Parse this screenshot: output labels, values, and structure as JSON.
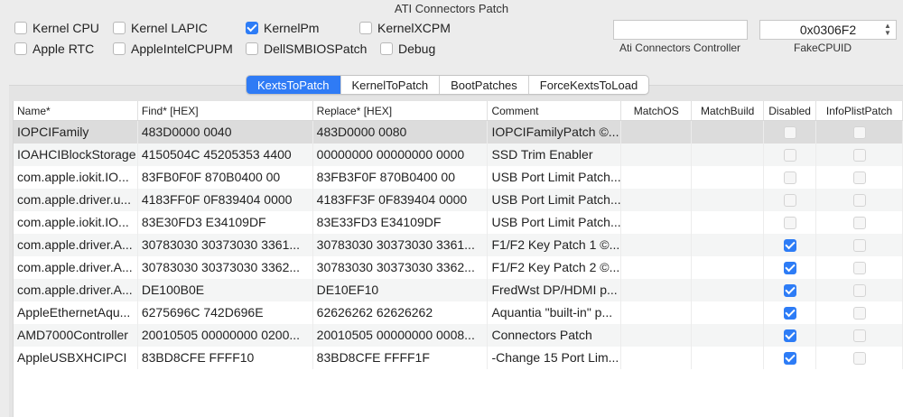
{
  "group_title": "ATI Connectors Patch",
  "checkboxes": [
    {
      "label": "Kernel CPU",
      "checked": false
    },
    {
      "label": "Kernel LAPIC",
      "checked": false
    },
    {
      "label": "KernelPm",
      "checked": true
    },
    {
      "label": "KernelXCPM",
      "checked": false
    },
    {
      "label": "Apple RTC",
      "checked": false
    },
    {
      "label": "AppleIntelCPUPM",
      "checked": false
    },
    {
      "label": "DellSMBIOSPatch",
      "checked": false
    },
    {
      "label": "Debug",
      "checked": false
    }
  ],
  "ati_controller": {
    "value": "",
    "label": "Ati Connectors Controller"
  },
  "fake_cpuid": {
    "value": "0x0306F2",
    "label": "FakeCPUID"
  },
  "tabs": [
    {
      "label": "KextsToPatch",
      "active": true
    },
    {
      "label": "KernelToPatch",
      "active": false
    },
    {
      "label": "BootPatches",
      "active": false
    },
    {
      "label": "ForceKextsToLoad",
      "active": false
    }
  ],
  "table": {
    "columns": [
      "Name*",
      "Find* [HEX]",
      "Replace* [HEX]",
      "Comment",
      "MatchOS",
      "MatchBuild",
      "Disabled",
      "InfoPlistPatch"
    ],
    "rows": [
      {
        "name": "IOPCIFamily",
        "find": "483D0000 0040",
        "replace": "483D0000 0080",
        "comment": "IOPCIFamilyPatch ©...",
        "matchos": "",
        "matchbuild": "",
        "disabled": false,
        "infoplist": false
      },
      {
        "name": "IOAHCIBlockStorage",
        "find": "4150504C 45205353 4400",
        "replace": "00000000 00000000 0000",
        "comment": "SSD Trim Enabler",
        "matchos": "",
        "matchbuild": "",
        "disabled": false,
        "infoplist": false
      },
      {
        "name": "com.apple.iokit.IO...",
        "find": "83FB0F0F 870B0400 00",
        "replace": "83FB3F0F 870B0400 00",
        "comment": "USB Port Limit Patch...",
        "matchos": "",
        "matchbuild": "",
        "disabled": false,
        "infoplist": false
      },
      {
        "name": "com.apple.driver.u...",
        "find": "4183FF0F 0F839404 0000",
        "replace": "4183FF3F 0F839404 0000",
        "comment": "USB Port Limit Patch...",
        "matchos": "",
        "matchbuild": "",
        "disabled": false,
        "infoplist": false
      },
      {
        "name": "com.apple.iokit.IO...",
        "find": "83E30FD3 E34109DF",
        "replace": "83E33FD3 E34109DF",
        "comment": "USB Port Limit Patch...",
        "matchos": "",
        "matchbuild": "",
        "disabled": false,
        "infoplist": false
      },
      {
        "name": "com.apple.driver.A...",
        "find": "30783030 30373030 3361...",
        "replace": "30783030 30373030 3361...",
        "comment": "F1/F2 Key Patch 1 ©...",
        "matchos": "",
        "matchbuild": "",
        "disabled": true,
        "infoplist": false
      },
      {
        "name": "com.apple.driver.A...",
        "find": "30783030 30373030 3362...",
        "replace": "30783030 30373030 3362...",
        "comment": "F1/F2 Key Patch 2 ©...",
        "matchos": "",
        "matchbuild": "",
        "disabled": true,
        "infoplist": false
      },
      {
        "name": "com.apple.driver.A...",
        "find": "DE100B0E",
        "replace": "DE10EF10",
        "comment": "FredWst DP/HDMI p...",
        "matchos": "",
        "matchbuild": "",
        "disabled": true,
        "infoplist": false
      },
      {
        "name": "AppleEthernetAqu...",
        "find": "6275696C 742D696E",
        "replace": "62626262 62626262",
        "comment": "Aquantia \"built-in\" p...",
        "matchos": "",
        "matchbuild": "",
        "disabled": true,
        "infoplist": false
      },
      {
        "name": "AMD7000Controller",
        "find": "20010505 00000000 0200...",
        "replace": "20010505 00000000 0008...",
        "comment": "Connectors Patch",
        "matchos": "",
        "matchbuild": "",
        "disabled": true,
        "infoplist": false
      },
      {
        "name": "AppleUSBXHCIPCI",
        "find": "83BD8CFE FFFF10",
        "replace": "83BD8CFE FFFF1F",
        "comment": "-Change 15 Port Lim...",
        "matchos": "",
        "matchbuild": "",
        "disabled": true,
        "infoplist": false
      }
    ]
  }
}
